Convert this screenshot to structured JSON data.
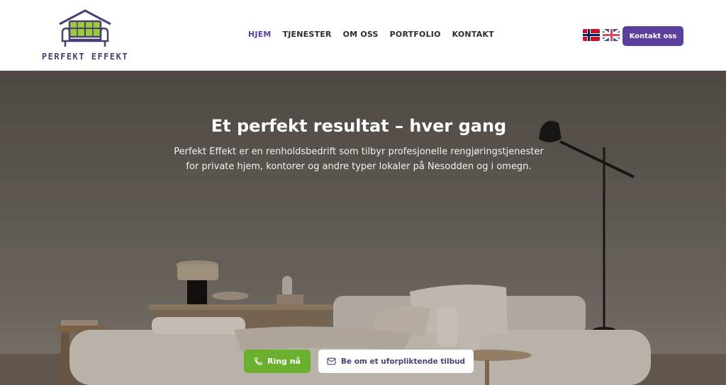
{
  "brand": {
    "logo_text": "PERFEKT EFFEKT",
    "primary_color": "#5b3f9e",
    "accent_green": "#6ab02e",
    "logo_icon": "house-sofa-logo"
  },
  "nav": {
    "items": [
      {
        "label": "HJEM",
        "active": true
      },
      {
        "label": "TJENESTER",
        "active": false
      },
      {
        "label": "OM OSS",
        "active": false
      },
      {
        "label": "PORTFOLIO",
        "active": false
      },
      {
        "label": "KONTAKT",
        "active": false
      }
    ]
  },
  "languages": {
    "norwegian": "norway-flag-icon",
    "english": "uk-flag-icon"
  },
  "header": {
    "contact_button": "Kontakt oss"
  },
  "hero": {
    "title": "Et perfekt resultat – hver gang",
    "subtitle": "Perfekt Effekt er en renholdsbedrift som tilbyr profesjonelle rengjøringstjenester for private hjem, kontorer og andre typer lokaler på Nesodden og i omegn.",
    "call_button": "Ring nå",
    "quote_button": "Be om et uforpliktende tilbud",
    "call_icon": "phone-icon",
    "quote_icon": "mail-icon"
  }
}
